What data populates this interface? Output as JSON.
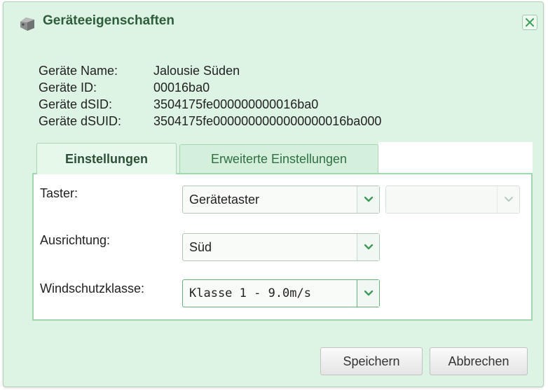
{
  "dialog": {
    "title": "Geräteeigenschaften",
    "title_icon": "device-icon",
    "close_icon": "close-icon"
  },
  "info": [
    {
      "label": "Geräte Name:",
      "value": "Jalousie Süden"
    },
    {
      "label": "Geräte ID:",
      "value": "00016ba0"
    },
    {
      "label": "Geräte dSID:",
      "value": "3504175fe000000000016ba0"
    },
    {
      "label": "Geräte dSUID:",
      "value": "3504175fe0000000000000000016ba000"
    }
  ],
  "tabs": [
    {
      "label": "Einstellungen",
      "active": true
    },
    {
      "label": "Erweiterte Einstellungen",
      "active": false
    }
  ],
  "settings": {
    "taster": {
      "label": "Taster:",
      "value": "Gerätetaster",
      "secondary_value": ""
    },
    "ausrichtung": {
      "label": "Ausrichtung:",
      "value": "Süd"
    },
    "windschutzklasse": {
      "label": "Windschutzklasse:",
      "value": "Klasse 1 - 9.0m/s"
    }
  },
  "buttons": {
    "save": "Speichern",
    "cancel": "Abbrechen"
  },
  "colors": {
    "window_bg": "#ddf3e3",
    "accent": "#2f8a4a",
    "title_text": "#2d5d3b",
    "panel_border": "#9fd8ae"
  }
}
